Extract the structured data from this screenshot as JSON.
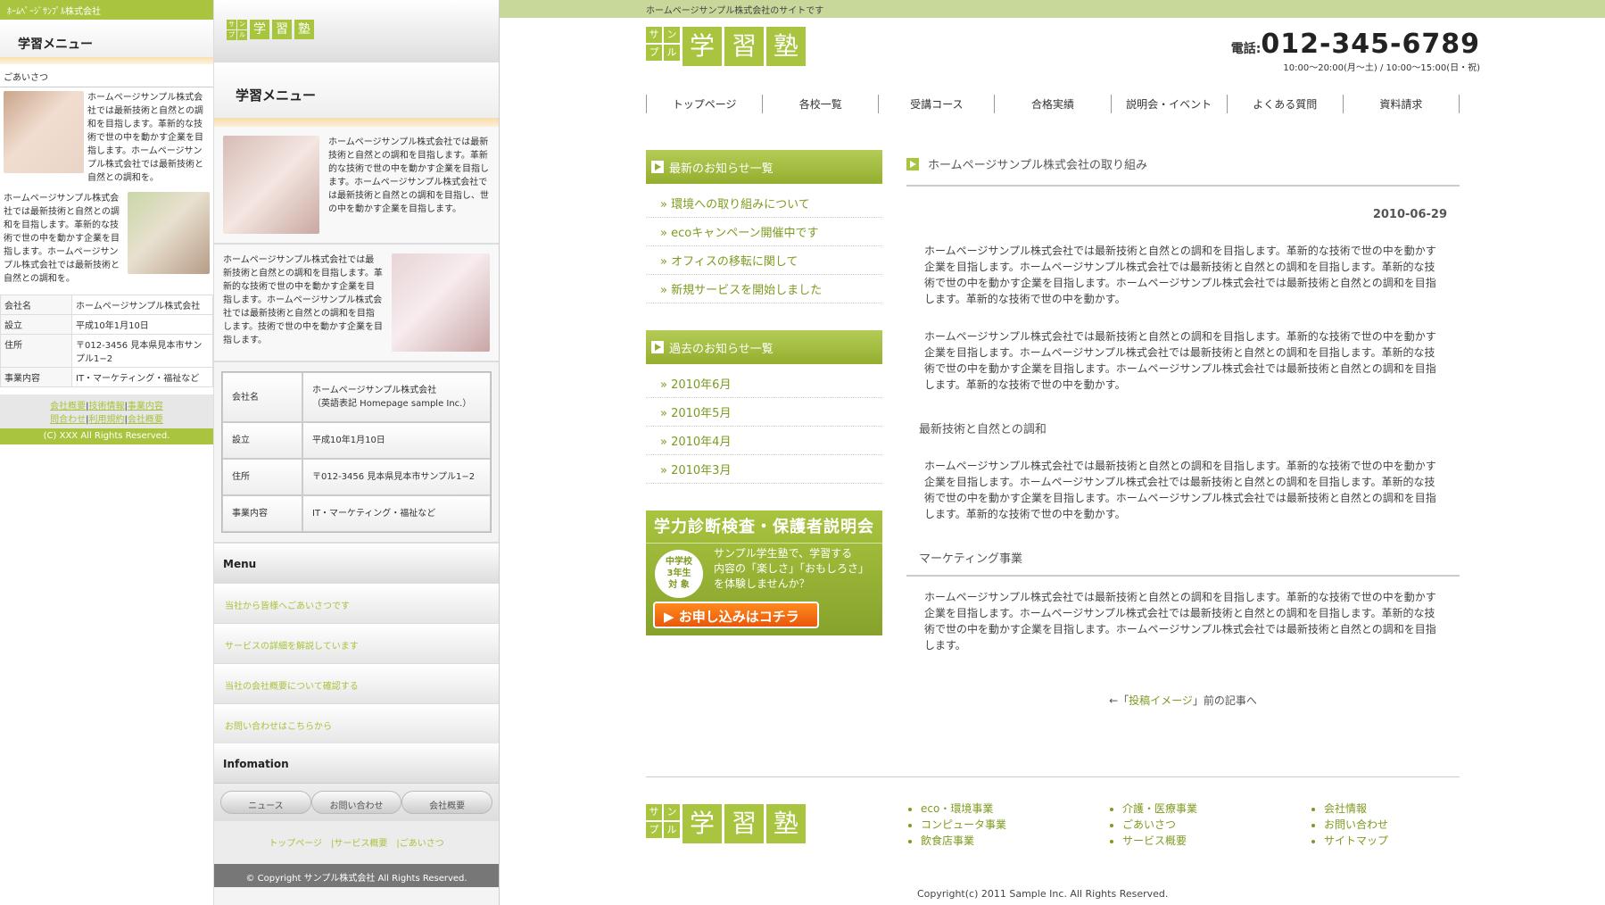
{
  "panel1": {
    "top_text": "ﾎｰﾑﾍﾟｰｼﾞｻﾝﾌﾟﾙ株式会社",
    "menu_title": "学習メニュー",
    "greeting": "ごあいさつ",
    "para1": "ホームページサンプル株式会社では最新技術と自然との調和を目指します。革新的な技術で世の中を動かす企業を目指します。ホームページサンプル株式会社では最新技術と自然との調和を。",
    "para2": "ホームページサンプル株式会社では最新技術と自然との調和を目指します。革新的な技術で世の中を動かす企業を目指します。ホームページサンプル株式会社では最新技術と自然との調和を。",
    "table": [
      [
        "会社名",
        "ホームページサンプル株式会社"
      ],
      [
        "設立",
        "平成10年1月10日"
      ],
      [
        "住所",
        "〒012-3456 見本県見本市サンプル1−2"
      ],
      [
        "事業内容",
        "IT・マーケティング・福祉など"
      ]
    ],
    "links1": [
      "会社概要",
      "技術情報",
      "事業内容"
    ],
    "links2": [
      "問合わせ",
      "利用規約",
      "会社概要"
    ],
    "copyright": "(C) XXX All Rights Reserved."
  },
  "panel2": {
    "menu_title": "学習メニュー",
    "para1": "ホームページサンプル株式会社では最新技術と自然との調和を目指します。革新的な技術で世の中を動かす企業を目指します。ホームページサンプル株式会社では最新技術と自然との調和を目指し、世の中を動かす企業を目指します。",
    "para2": "ホームページサンプル株式会社では最新技術と自然との調和を目指します。革新的な技術で世の中を動かす企業を目指します。ホームページサンプル株式会社では最新技術と自然との調和を目指します。技術で世の中を動かす企業を目指します。",
    "table": [
      {
        "k": "会社名",
        "v": "ホームページサンプル株式会社\n（英語表記 Homepage sample Inc.）"
      },
      {
        "k": "設立",
        "v": "平成10年1月10日"
      },
      {
        "k": "住所",
        "v": "〒012-3456 見本県見本市サンプル1−2"
      },
      {
        "k": "事業内容",
        "v": "IT・マーケティング・福祉など"
      }
    ],
    "menu_label": "Menu",
    "menu_items": [
      "当社から皆様へごあいさつです",
      "サービスの詳細を解説しています",
      "当社の会社概要について確認する",
      "お問い合わせはこちらから"
    ],
    "info_label": "Infomation",
    "buttons": [
      "ニュース",
      "お問い合わせ",
      "会社概要"
    ],
    "foot_links": "トップページ　|サービス概要　|ごあいさつ",
    "copyright": "© Copyright サンプル株式会社 All Rights Reserved."
  },
  "panel3": {
    "top_text": "ホームページサンプル株式会社のサイトです",
    "logo_small": [
      "サ",
      "ン",
      "プ",
      "ル"
    ],
    "logo_big": [
      "学",
      "習",
      "塾"
    ],
    "tel_label": "電話:",
    "tel_number": "012-345-6789",
    "tel_hours": "10:00〜20:00(月〜土) / 10:00〜15:00(日・祝)",
    "nav": [
      "トップページ",
      "各校一覧",
      "受講コース",
      "合格実績",
      "説明会・イベント",
      "よくある質問",
      "資料請求"
    ],
    "latest_title": "最新のお知らせ一覧",
    "latest": [
      "環境への取り組みについて",
      "ecoキャンペーン開催中です",
      "オフィスの移転に関して",
      "新規サービスを開始しました"
    ],
    "past_title": "過去のお知らせ一覧",
    "past": [
      "2010年6月",
      "2010年5月",
      "2010年4月",
      "2010年3月"
    ],
    "banner_title": "学力診断検査・保護者説明会",
    "banner_badge": "中学校\n3年生\n対 象",
    "banner_text": "サンプル学生塾で、学習する\n内容の「楽しさ」「おもしろさ」\nを体験しませんか？",
    "banner_cta": "▶ お申し込みはコチラ",
    "article_title": "ホームページサンプル株式会社の取り組み",
    "date": "2010-06-29",
    "p1": "ホームページサンプル株式会社では最新技術と自然との調和を目指します。革新的な技術で世の中を動かす企業を目指します。ホームページサンプル株式会社では最新技術と自然との調和を目指します。革新的な技術で世の中を動かす企業を目指します。ホームページサンプル株式会社では最新技術と自然との調和を目指します。革新的な技術で世の中を動かす。",
    "p2": "ホームページサンプル株式会社では最新技術と自然との調和を目指します。革新的な技術で世の中を動かす企業を目指します。ホームページサンプル株式会社では最新技術と自然との調和を目指します。革新的な技術で世の中を動かす企業を目指します。ホームページサンプル株式会社では最新技術と自然との調和を目指します。革新的な技術で世の中を動かす。",
    "sub1": "最新技術と自然との調和",
    "p3": "ホームページサンプル株式会社では最新技術と自然との調和を目指します。革新的な技術で世の中を動かす企業を目指します。ホームページサンプル株式会社では最新技術と自然との調和を目指します。革新的な技術で世の中を動かす企業を目指します。ホームページサンプル株式会社では最新技術と自然との調和を目指します。革新的な技術で世の中を動かす。",
    "sub2": "マーケティング事業",
    "p4": "ホームページサンプル株式会社では最新技術と自然との調和を目指します。革新的な技術で世の中を動かす企業を目指します。ホームページサンプル株式会社では最新技術と自然との調和を目指します。革新的な技術で世の中を動かす企業を目指します。ホームページサンプル株式会社では最新技術と自然との調和を目指します。",
    "back_prefix": "←「",
    "back_link": "投稿イメージ",
    "back_suffix": "」前の記事へ",
    "footer_cols": [
      [
        "eco・環境事業",
        "コンピュータ事業",
        "飲食店事業"
      ],
      [
        "介護・医療事業",
        "ごあいさつ",
        "サービス概要"
      ],
      [
        "会社情報",
        "お問い合わせ",
        "サイトマップ"
      ]
    ],
    "footer_copy": "Copyright(c) 2011 Sample Inc. All Rights Reserved."
  },
  "colors": {
    "accent": "#a9c43f",
    "accent_dark": "#7d9b20",
    "cta": "#f07015"
  }
}
